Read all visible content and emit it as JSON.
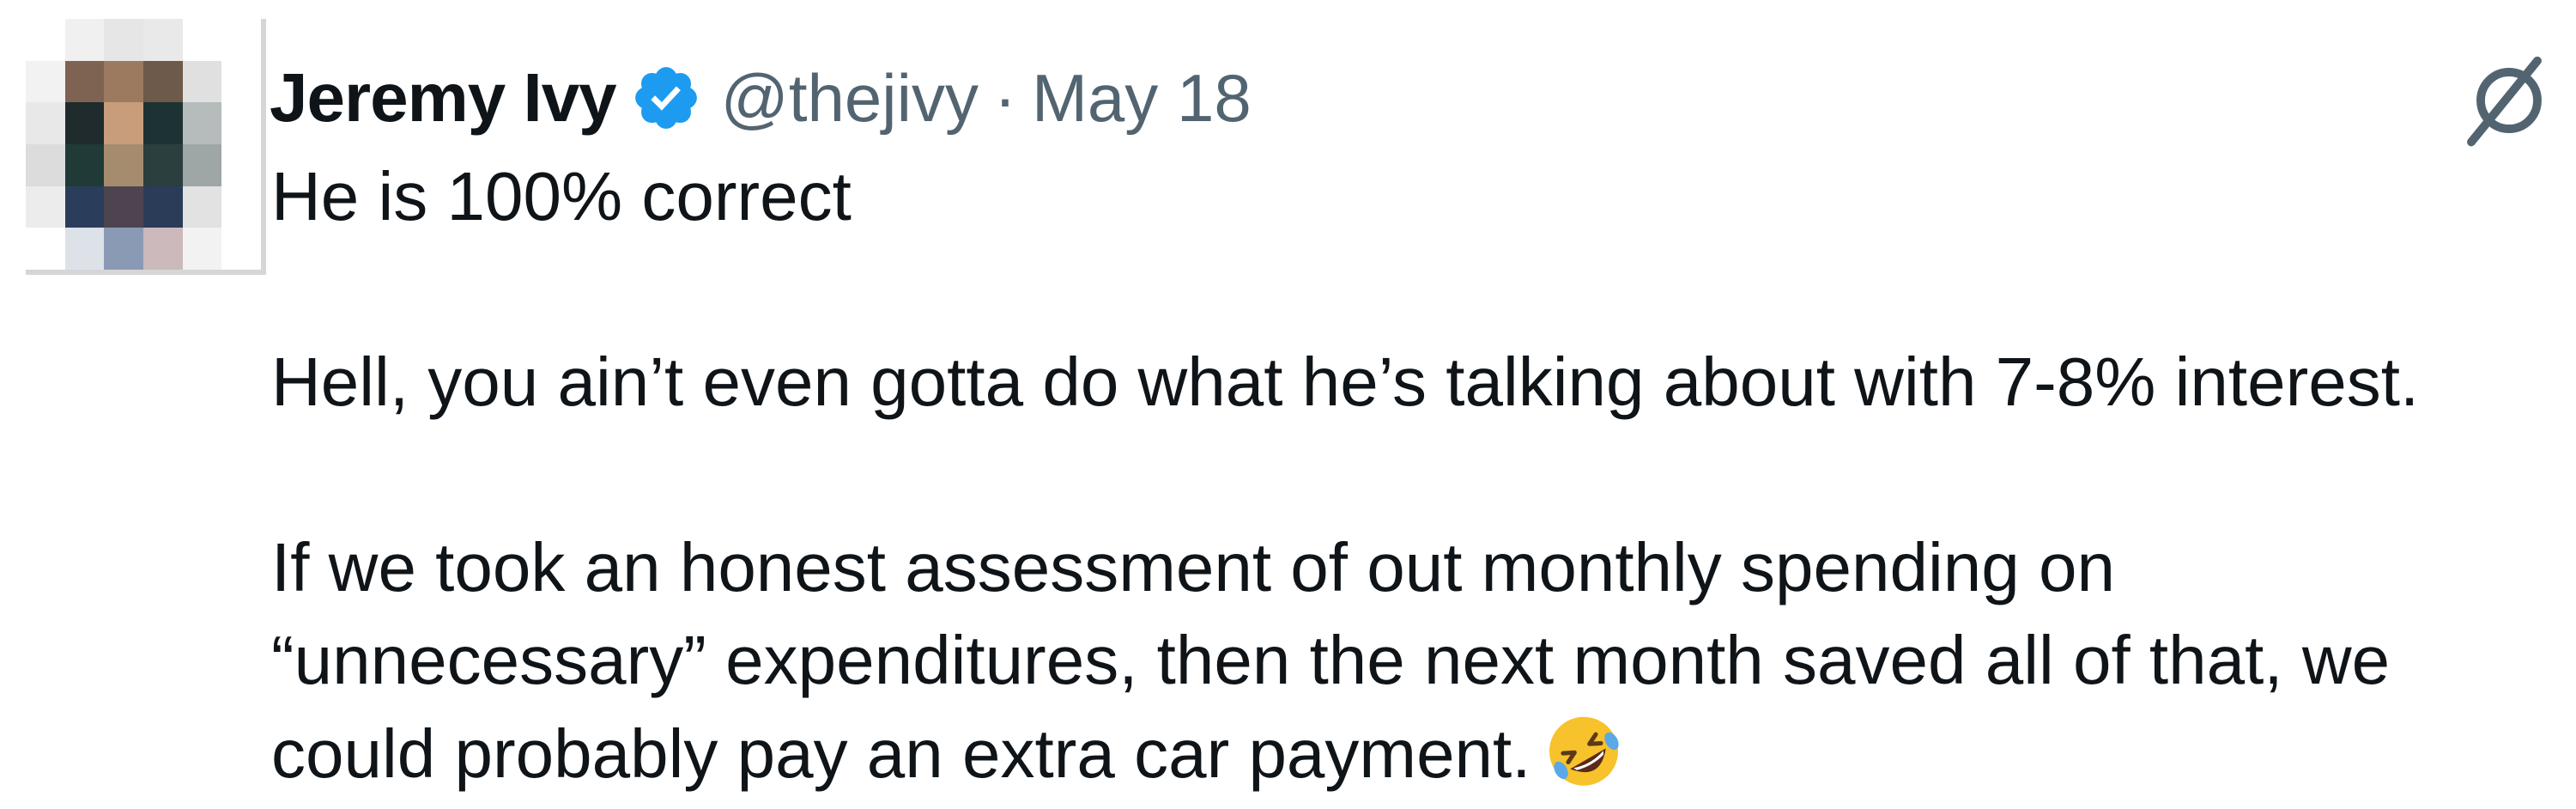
{
  "tweet": {
    "author_name": "Jeremy Ivy",
    "handle": "@thejivy",
    "separator": "·",
    "date": "May 18",
    "lines": [
      "He is 100% correct",
      "Hell, you ain’t even gotta do what he’s talking about with 7-8% interest.",
      "If we took an honest assessment of out monthly spending on",
      "“unnecessary” expenditures, then the next month saved all of that, we",
      "could probably pay an extra car payment."
    ],
    "emoji": "rolling-on-the-floor-laughing"
  },
  "icons": {
    "verified": "verified-badge-icon",
    "menu": "grok-icon"
  },
  "colors": {
    "text": "#0f1419",
    "secondary": "#536471",
    "verified": "#1d9bf0"
  }
}
